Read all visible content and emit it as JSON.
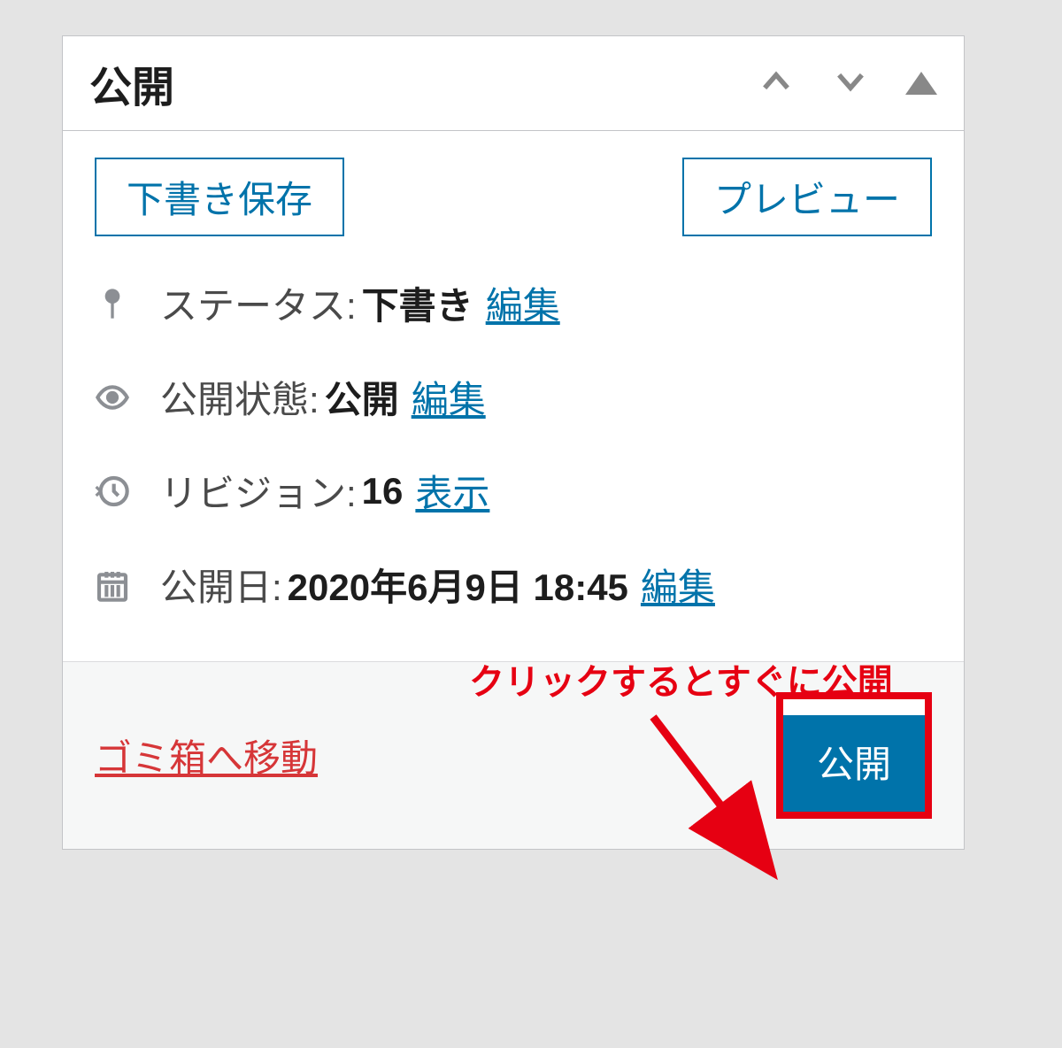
{
  "panel": {
    "title": "公開",
    "buttons": {
      "save_draft": "下書き保存",
      "preview": "プレビュー"
    },
    "status": {
      "label": "ステータス:",
      "value": "下書き",
      "edit_link": "編集"
    },
    "visibility": {
      "label": "公開状態:",
      "value": "公開",
      "edit_link": "編集"
    },
    "revisions": {
      "label": "リビジョン:",
      "value": "16",
      "show_link": "表示"
    },
    "publish_date": {
      "label": "公開日:",
      "value": "2020年6月9日 18:45",
      "edit_link": "編集"
    },
    "footer": {
      "trash_link": "ゴミ箱へ移動",
      "publish_button": "公開"
    }
  },
  "annotation": {
    "text": "クリックするとすぐに公開"
  }
}
